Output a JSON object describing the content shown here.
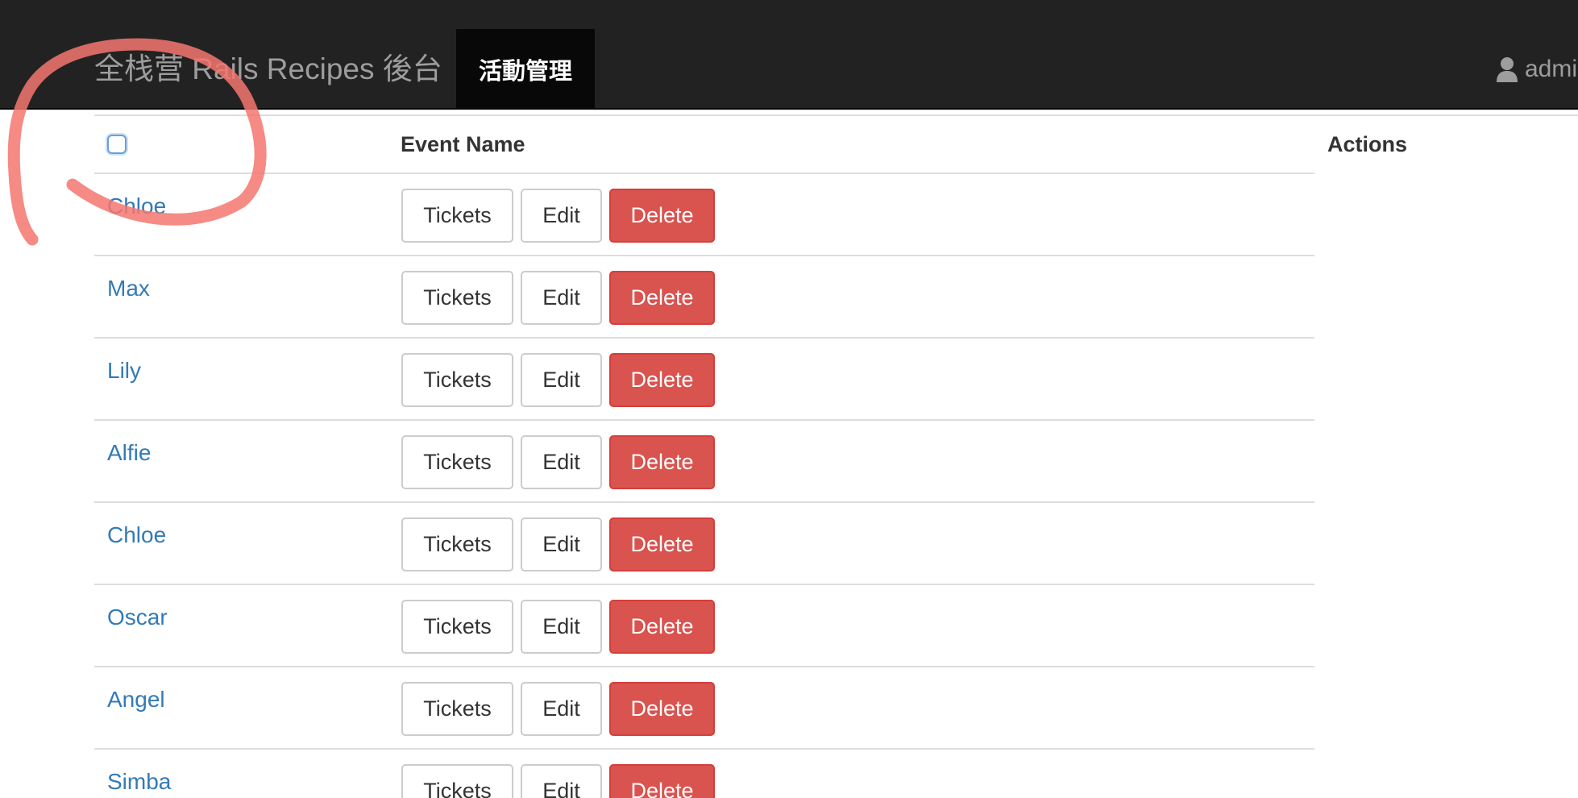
{
  "navbar": {
    "brand": "全栈营 Rails Recipes 後台",
    "active_item": "活動管理",
    "user_label": "admin"
  },
  "table": {
    "columns": {
      "event_name": "Event Name",
      "actions": "Actions"
    },
    "rows": [
      {
        "name": "Chloe"
      },
      {
        "name": "Max"
      },
      {
        "name": "Lily"
      },
      {
        "name": "Alfie"
      },
      {
        "name": "Chloe"
      },
      {
        "name": "Oscar"
      },
      {
        "name": "Angel"
      },
      {
        "name": "Simba"
      }
    ],
    "buttons": {
      "tickets": "Tickets",
      "edit": "Edit",
      "delete": "Delete"
    }
  },
  "colors": {
    "navbar_bg": "#222222",
    "active_nav_bg": "#080808",
    "link": "#337ab7",
    "danger": "#d9534f",
    "annotation": "#f4756f"
  },
  "icons": {
    "user": "user-icon",
    "annotation": "hand-drawn-circle"
  }
}
